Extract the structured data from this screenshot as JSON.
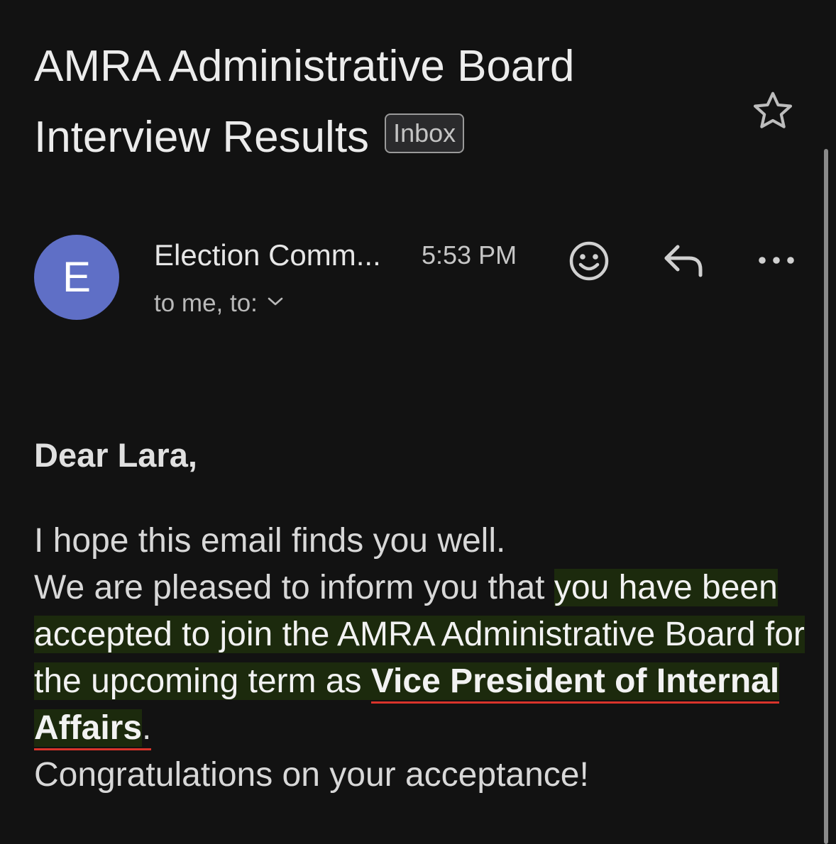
{
  "email": {
    "subject": "AMRA Administrative Board Interview Results",
    "label": "Inbox",
    "sender_name": "Election Comm...",
    "avatar_initial": "E",
    "time": "5:53 PM",
    "recipients": "to me, to:"
  },
  "body": {
    "greeting": "Dear Lara,",
    "line1": "I hope this email finds you well.",
    "line2_pre": "We are pleased to inform you that ",
    "line2_highlight": "you have been accepted to join the AMRA Administrative Board for the upcoming term as ",
    "position": "Vice President of Internal Affairs",
    "period": ".",
    "closing": "Congratulations on your acceptance!"
  },
  "icons": {
    "star": "star-outline-icon",
    "emoji": "smiley-icon",
    "reply": "reply-icon",
    "more": "more-horizontal-icon",
    "expand": "chevron-down-icon"
  },
  "colors": {
    "background": "#121212",
    "avatar": "#5f6fc6",
    "highlight": "#1c2a0d",
    "underline": "#d9342b"
  }
}
